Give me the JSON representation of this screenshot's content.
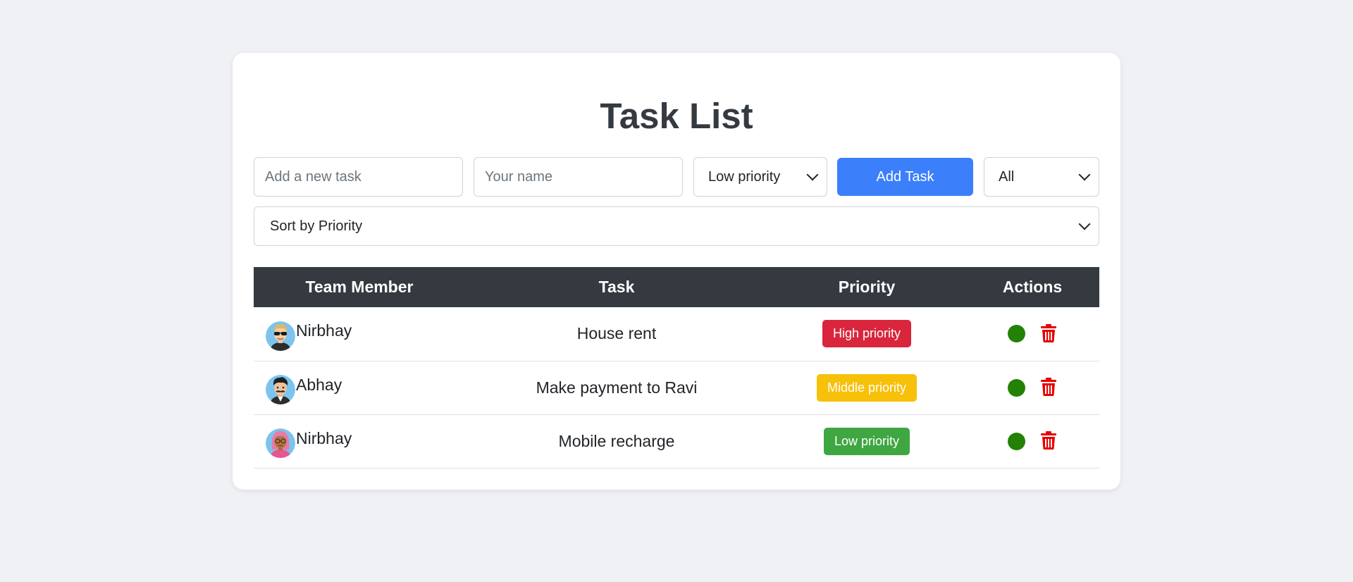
{
  "title": "Task List",
  "form": {
    "task_placeholder": "Add a new task",
    "name_placeholder": "Your name",
    "priority_selected": "Low priority",
    "add_button": "Add Task",
    "filter_selected": "All",
    "sort_selected": "Sort by Priority"
  },
  "table": {
    "headers": [
      "Team Member",
      "Task",
      "Priority",
      "Actions"
    ],
    "rows": [
      {
        "member": "Nirbhay",
        "avatar": "avatar-sunglasses-icon",
        "task": "House rent",
        "priority": "High priority",
        "priority_color": "#d9263d"
      },
      {
        "member": "Abhay",
        "avatar": "avatar-mustache-icon",
        "task": "Make payment to Ravi",
        "priority": "Middle priority",
        "priority_color": "#f7c009"
      },
      {
        "member": "Nirbhay",
        "avatar": "avatar-pink-hair-icon",
        "task": "Mobile recharge",
        "priority": "Low priority",
        "priority_color": "#40a641"
      }
    ]
  },
  "colors": {
    "accent": "#3b7ffa",
    "header_bg": "#343a40",
    "complete_dot": "#238206",
    "delete_icon": "#e60000"
  }
}
